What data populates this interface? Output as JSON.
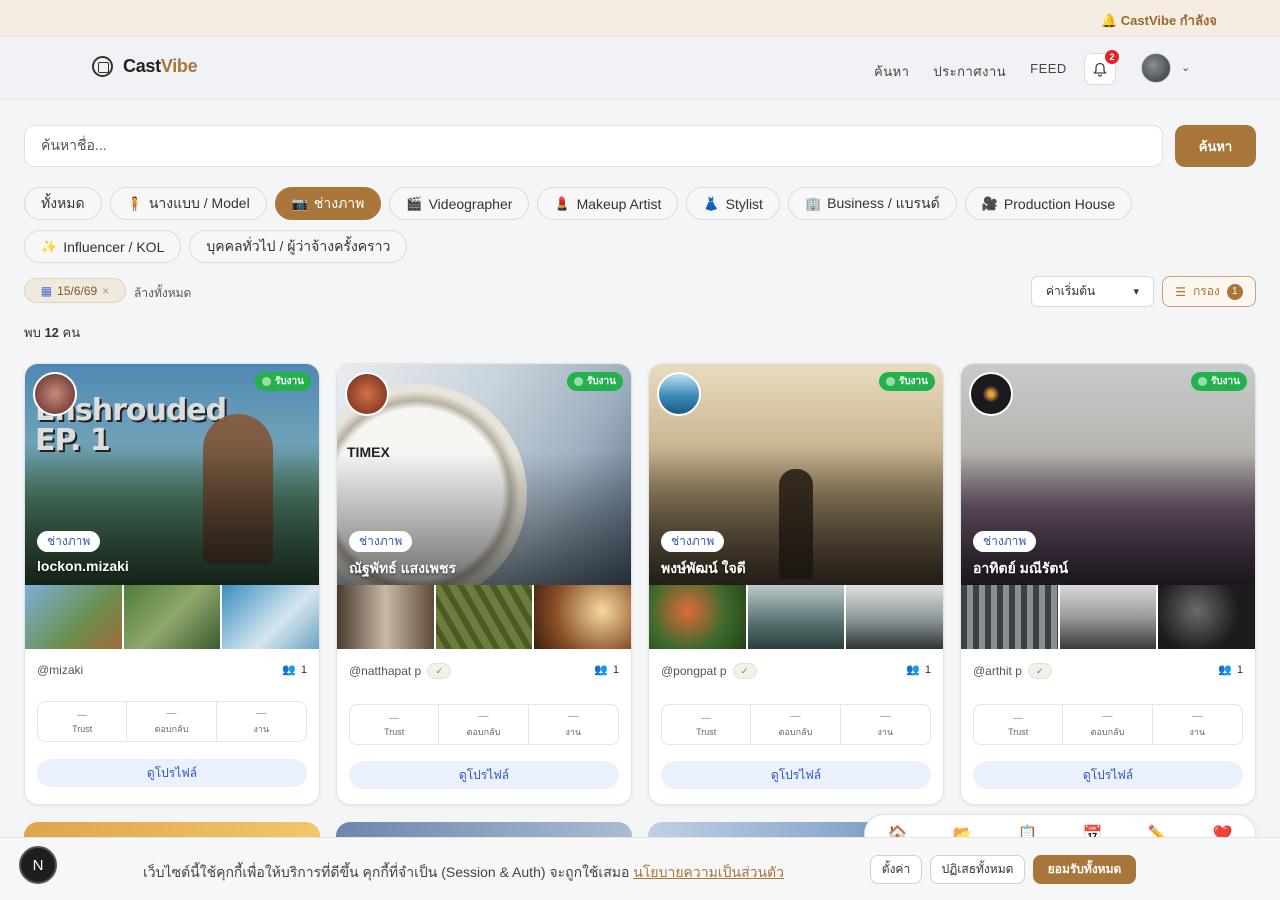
{
  "announcement": "🔔 CastVibe กำลังจ",
  "brand": {
    "name_a": "Cast",
    "name_b": "Vibe"
  },
  "nav": {
    "links": [
      "ค้นหา",
      "ประกาศงาน",
      "FEED"
    ],
    "notif_count": "2"
  },
  "search": {
    "placeholder": "ค้นหาชื่อ...",
    "button": "ค้นหา"
  },
  "categories": [
    {
      "label": "ทั้งหมด",
      "icon": ""
    },
    {
      "label": "นางแบบ / Model",
      "icon": "🧍"
    },
    {
      "label": "ช่างภาพ",
      "icon": "📷",
      "active": true
    },
    {
      "label": "Videographer",
      "icon": "🎬"
    },
    {
      "label": "Makeup Artist",
      "icon": "💄"
    },
    {
      "label": "Stylist",
      "icon": "👗"
    },
    {
      "label": "Business / แบรนด์",
      "icon": "🏢"
    },
    {
      "label": "Production House",
      "icon": "🎥"
    },
    {
      "label": "Influencer / KOL",
      "icon": "✨"
    },
    {
      "label": "บุคคลทั่วไป / ผู้ว่าจ้างครั้งคราว",
      "icon": ""
    }
  ],
  "filters": {
    "date_chip": "15/6/69",
    "clear_all": "ล้างทั้งหมด",
    "sort_value": "ค่าเริ่มต้น",
    "filter_label": "กรอง",
    "filter_count": "1"
  },
  "results": {
    "prefix": "พบ",
    "count": "12",
    "suffix": "คน"
  },
  "card_labels": {
    "open": "รับงาน",
    "trust": "Trust",
    "replies": "ตอบกลับ",
    "jobs": "งาน",
    "empty": "—",
    "view_profile": "ดูโปรไฟล์"
  },
  "cards": [
    {
      "name": "lockon.mizaki",
      "role": "ช่างภาพ",
      "handle": "@mizaki",
      "verified": false,
      "members": "1",
      "hero_text": "Enshrouded\nEP. 1"
    },
    {
      "name": "ณัฐพัทธ์ แสงเพชร",
      "role": "ช่างภาพ",
      "handle": "@natthapat p",
      "verified": true,
      "members": "1"
    },
    {
      "name": "พงษ์พัฒน์ ใจดี",
      "role": "ช่างภาพ",
      "handle": "@pongpat p",
      "verified": true,
      "members": "1"
    },
    {
      "name": "อาทิตย์ มณีรัตน์",
      "role": "ช่างภาพ",
      "handle": "@arthit p",
      "verified": true,
      "members": "1"
    }
  ],
  "cookie": {
    "text": "เว็บไซต์นี้ใช้คุกกี้เพื่อให้บริการที่ดีขึ้น คุกกี้ที่จำเป็น (Session & Auth) จะถูกใช้เสมอ ",
    "link": "นโยบายความเป็นส่วนตัว",
    "settings": "ตั้งค่า",
    "reject": "ปฏิเสธทั้งหมด",
    "accept": "ยอมรับทั้งหมด",
    "n_badge": "N"
  },
  "dock_icons": [
    "🏠",
    "📂",
    "📋",
    "📅",
    "✏️",
    "❤️"
  ],
  "colors": {
    "accent": "#a8763a",
    "open_green": "#23b14d",
    "link_blue": "#2c59c7"
  }
}
